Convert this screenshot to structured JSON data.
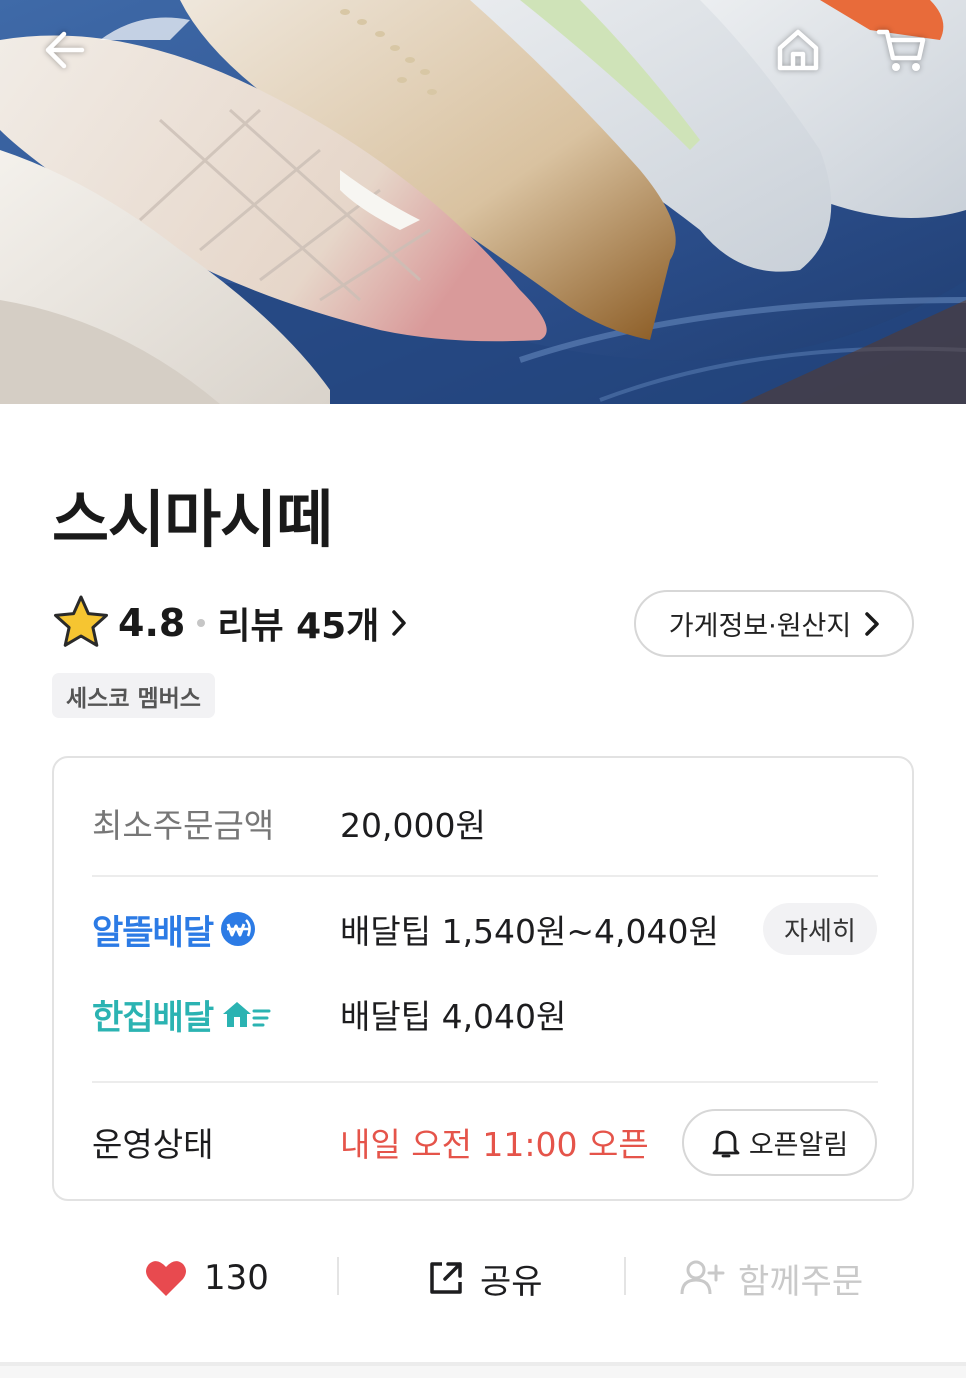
{
  "store": {
    "name": "스시마시떼",
    "rating": "4.8",
    "review_link": "리뷰 45개",
    "info_button": "가게정보·원산지",
    "tag": "세스코 멤버스"
  },
  "details": {
    "min_order_label": "최소주문금액",
    "min_order_value": "20,000원",
    "economy_delivery_brand": "알뜰배달",
    "economy_delivery_fee": "배달팁 1,540원~4,040원",
    "detail_button": "자세히",
    "single_delivery_brand": "한집배달",
    "single_delivery_fee": "배달팁 4,040원",
    "status_label": "운영상태",
    "status_value": "내일 오전 11:00 오픈",
    "open_alert_button": "오픈알림"
  },
  "actions": {
    "like_count": "130",
    "share_label": "공유",
    "group_order_label": "함께주문"
  },
  "icons": {
    "back": "back-arrow-icon",
    "home": "home-icon",
    "cart": "cart-icon",
    "star": "star-icon",
    "heart": "heart-icon",
    "share": "share-icon",
    "add_person": "add-person-icon",
    "bell": "bell-icon"
  },
  "colors": {
    "economy_brand": "#2c7be5",
    "single_brand": "#2bb3b2",
    "status_closed": "#e5544a",
    "heart": "#e84a4f",
    "star": "#f6c531",
    "disabled": "#c9c9c9"
  }
}
